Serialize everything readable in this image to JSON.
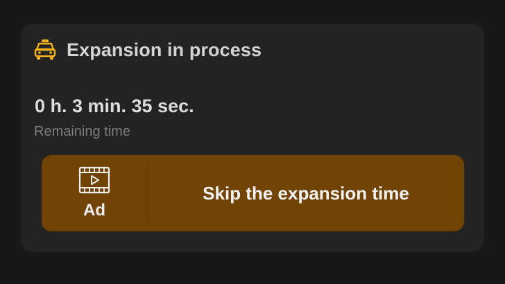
{
  "card": {
    "title": "Expansion in process",
    "title_icon": "taxi-icon",
    "icon_color": "#f5b21a"
  },
  "timer": {
    "value": "0 h. 3 min. 35 sec.",
    "label": "Remaining time"
  },
  "skip_button": {
    "ad_icon": "video-play-icon",
    "ad_label": "Ad",
    "label": "Skip the expansion time",
    "background": "#714405"
  }
}
